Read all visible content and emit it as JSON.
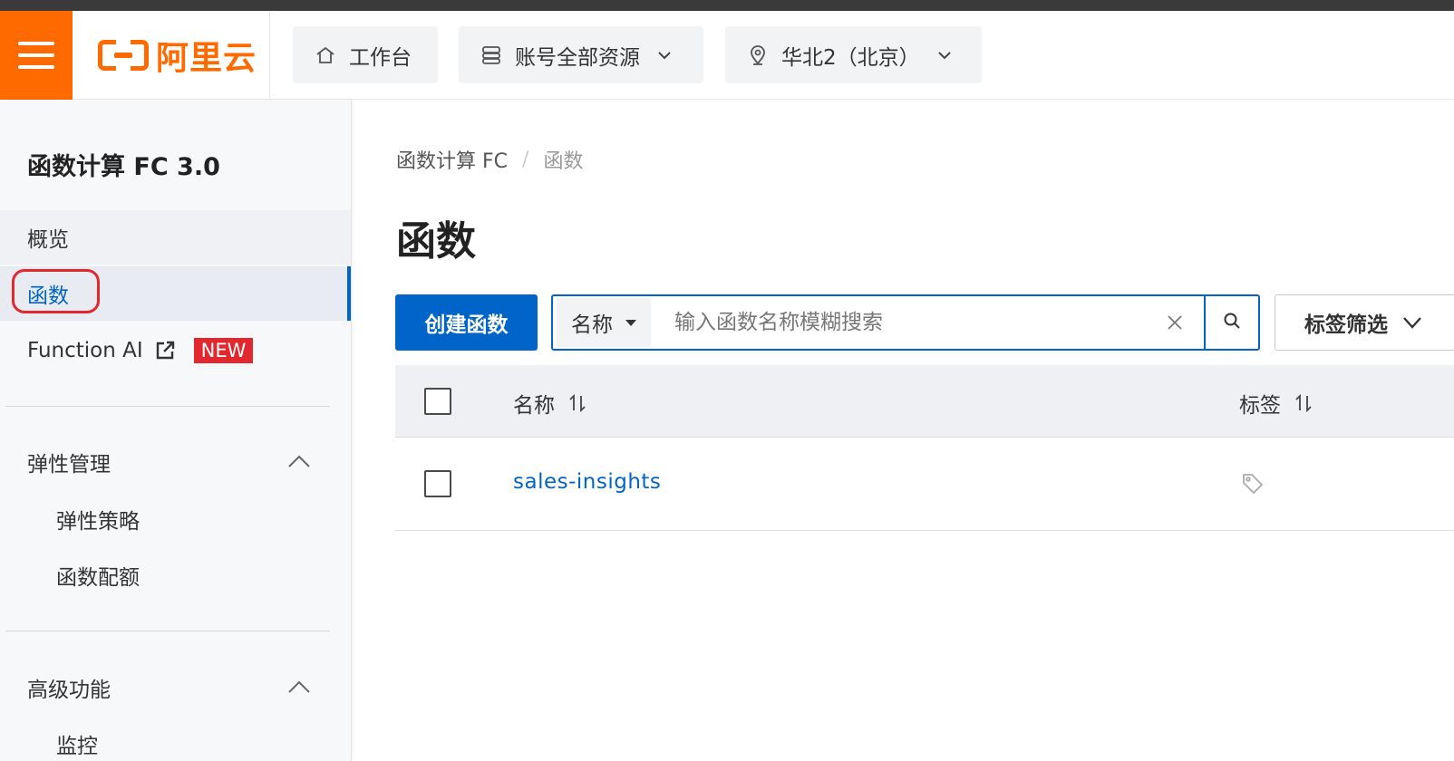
{
  "header": {
    "brand_text": "阿里云",
    "workbench_label": "工作台",
    "resources_label": "账号全部资源",
    "region_label": "华北2（北京）"
  },
  "sidebar": {
    "title": "函数计算 FC 3.0",
    "items": [
      {
        "label": "概览"
      },
      {
        "label": "函数",
        "active": true
      },
      {
        "label": "Function AI",
        "badge": "NEW"
      }
    ],
    "groups": [
      {
        "label": "弹性管理",
        "expanded": true,
        "children": [
          "弹性策略",
          "函数配额"
        ]
      },
      {
        "label": "高级功能",
        "expanded": true,
        "children": [
          "监控"
        ]
      }
    ]
  },
  "main": {
    "breadcrumb": [
      "函数计算 FC",
      "函数"
    ],
    "title": "函数",
    "create_button": "创建函数",
    "search": {
      "field": "名称",
      "placeholder": "输入函数名称模糊搜索",
      "value": ""
    },
    "tag_filter_label": "标签筛选",
    "table": {
      "columns": [
        "名称",
        "标签"
      ],
      "rows": [
        {
          "name": "sales-insights",
          "tags": ""
        }
      ]
    }
  },
  "colors": {
    "brand_orange": "#ff6a00",
    "primary_blue": "#0064c8",
    "highlight_red": "#e0282e"
  },
  "icons": [
    "menu-icon",
    "home-icon",
    "server-icon",
    "location-pin-icon",
    "chevron-down-icon",
    "external-link-icon",
    "chevron-up-icon",
    "close-icon",
    "search-icon",
    "sort-icon",
    "tag-icon"
  ]
}
